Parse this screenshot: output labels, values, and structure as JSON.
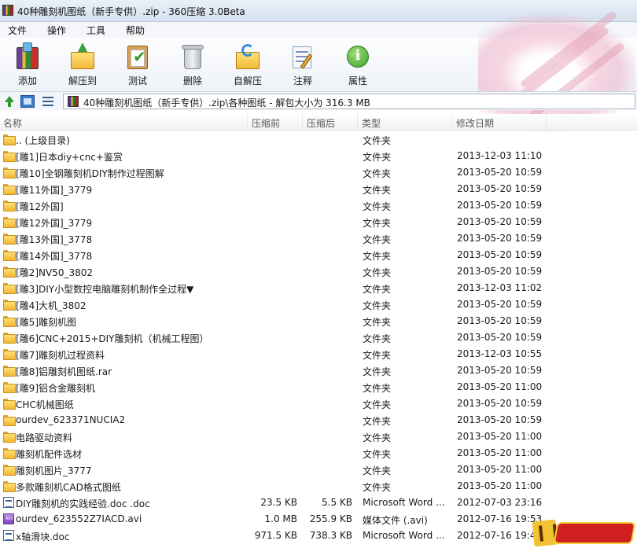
{
  "window": {
    "title": "40种雕刻机图纸（新手专供）.zip - 360压缩 3.0Beta"
  },
  "menu": [
    "文件",
    "操作",
    "工具",
    "帮助"
  ],
  "toolbar": {
    "add": "添加",
    "extract": "解压到",
    "test": "测试",
    "delete": "删除",
    "sfx": "自解压",
    "comment": "注释",
    "properties": "属性"
  },
  "address": {
    "path": "40种雕刻机图纸（新手专供）.zip\\各种图纸 - 解包大小为 316.3 MB"
  },
  "columns": {
    "name": "名称",
    "size": "压缩前",
    "packed": "压缩后",
    "type": "类型",
    "modified": "修改日期"
  },
  "files": [
    {
      "icon": "folder",
      "name": ".. (上级目录)",
      "size": "",
      "packed": "",
      "type": "文件夹",
      "modified": ""
    },
    {
      "icon": "folder",
      "name": "[雕1]日本diy+cnc+鉴赏",
      "size": "",
      "packed": "",
      "type": "文件夹",
      "modified": "2013-12-03 11:10"
    },
    {
      "icon": "folder",
      "name": "[雕10]全钢雕刻机DIY制作过程图解",
      "size": "",
      "packed": "",
      "type": "文件夹",
      "modified": "2013-05-20 10:59"
    },
    {
      "icon": "folder",
      "name": "[雕11外国]_3779",
      "size": "",
      "packed": "",
      "type": "文件夹",
      "modified": "2013-05-20 10:59"
    },
    {
      "icon": "folder",
      "name": "[雕12外国]",
      "size": "",
      "packed": "",
      "type": "文件夹",
      "modified": "2013-05-20 10:59"
    },
    {
      "icon": "folder",
      "name": "[雕12外国]_3779",
      "size": "",
      "packed": "",
      "type": "文件夹",
      "modified": "2013-05-20 10:59"
    },
    {
      "icon": "folder",
      "name": "[雕13外国]_3778",
      "size": "",
      "packed": "",
      "type": "文件夹",
      "modified": "2013-05-20 10:59"
    },
    {
      "icon": "folder",
      "name": "[雕14外国]_3778",
      "size": "",
      "packed": "",
      "type": "文件夹",
      "modified": "2013-05-20 10:59"
    },
    {
      "icon": "folder",
      "name": "[雕2]NV50_3802",
      "size": "",
      "packed": "",
      "type": "文件夹",
      "modified": "2013-05-20 10:59"
    },
    {
      "icon": "folder",
      "name": "[雕3]DIY小型数控电脑雕刻机制作全过程▼",
      "size": "",
      "packed": "",
      "type": "文件夹",
      "modified": "2013-12-03 11:02"
    },
    {
      "icon": "folder",
      "name": "[雕4]大机_3802",
      "size": "",
      "packed": "",
      "type": "文件夹",
      "modified": "2013-05-20 10:59"
    },
    {
      "icon": "folder",
      "name": "[雕5]雕刻机图",
      "size": "",
      "packed": "",
      "type": "文件夹",
      "modified": "2013-05-20 10:59"
    },
    {
      "icon": "folder",
      "name": "[雕6]CNC+2015+DIY雕刻机（机械工程图）",
      "size": "",
      "packed": "",
      "type": "文件夹",
      "modified": "2013-05-20 10:59"
    },
    {
      "icon": "folder",
      "name": "[雕7]雕刻机过程资料",
      "size": "",
      "packed": "",
      "type": "文件夹",
      "modified": "2013-12-03 10:55"
    },
    {
      "icon": "folder",
      "name": "[雕8]铝雕刻机图纸.rar",
      "size": "",
      "packed": "",
      "type": "文件夹",
      "modified": "2013-05-20 10:59"
    },
    {
      "icon": "folder",
      "name": "[雕9]铝合金雕刻机",
      "size": "",
      "packed": "",
      "type": "文件夹",
      "modified": "2013-05-20 11:00"
    },
    {
      "icon": "folder",
      "name": "CHC机械图纸",
      "size": "",
      "packed": "",
      "type": "文件夹",
      "modified": "2013-05-20 10:59"
    },
    {
      "icon": "folder",
      "name": "ourdev_623371NUCIA2",
      "size": "",
      "packed": "",
      "type": "文件夹",
      "modified": "2013-05-20 10:59"
    },
    {
      "icon": "folder",
      "name": "电路驱动资料",
      "size": "",
      "packed": "",
      "type": "文件夹",
      "modified": "2013-05-20 11:00"
    },
    {
      "icon": "folder",
      "name": "雕刻机配件选材",
      "size": "",
      "packed": "",
      "type": "文件夹",
      "modified": "2013-05-20 11:00"
    },
    {
      "icon": "folder",
      "name": "雕刻机图片_3777",
      "size": "",
      "packed": "",
      "type": "文件夹",
      "modified": "2013-05-20 11:00"
    },
    {
      "icon": "folder",
      "name": "多款雕刻机CAD格式图纸",
      "size": "",
      "packed": "",
      "type": "文件夹",
      "modified": "2013-05-20 11:00"
    },
    {
      "icon": "doc",
      "name": "DIY雕刻机的实践经验.doc .doc",
      "size": "23.5 KB",
      "packed": "5.5 KB",
      "type": "Microsoft Word ...",
      "modified": "2012-07-03 23:16"
    },
    {
      "icon": "avi",
      "name": "ourdev_623552Z7IACD.avi",
      "size": "1.0 MB",
      "packed": "255.9 KB",
      "type": "媒体文件 (.avi)",
      "modified": "2012-07-16 19:53"
    },
    {
      "icon": "doc",
      "name": "x轴滑块.doc",
      "size": "971.5 KB",
      "packed": "738.3 KB",
      "type": "Microsoft Word ...",
      "modified": "2012-07-16 19:48"
    }
  ],
  "icons": {
    "app": "winrar-books-icon",
    "add": "add-archive-icon",
    "extract": "extract-folder-icon",
    "test": "test-clipboard-icon",
    "delete": "trash-bin-icon",
    "sfx": "sfx-folder-icon",
    "comment": "comment-notepad-icon",
    "properties": "info-icon"
  },
  "colors": {
    "folder": "#f3b735",
    "accent": "#3a78c8"
  }
}
